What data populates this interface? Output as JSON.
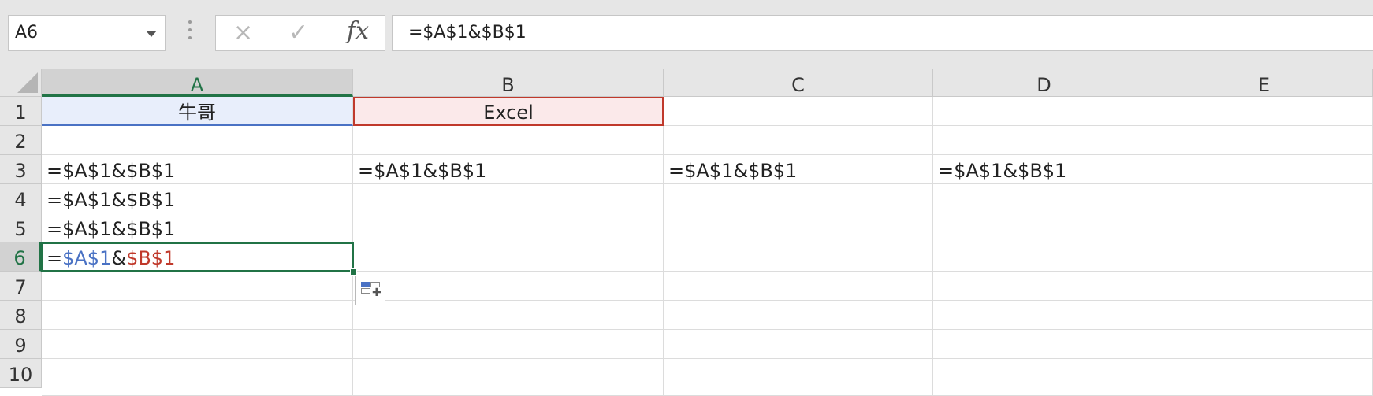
{
  "formula_bar": {
    "name_box": "A6",
    "cancel_icon": "×",
    "enter_icon": "✓",
    "fx_label": "fx",
    "formula": "=$A$1&$B$1"
  },
  "columns": [
    "A",
    "B",
    "C",
    "D",
    "E"
  ],
  "rows": [
    "1",
    "2",
    "3",
    "4",
    "5",
    "6",
    "7",
    "8",
    "9",
    "10"
  ],
  "cells": {
    "A1": "牛哥",
    "B1": "Excel",
    "A3": "=$A$1&$B$1",
    "B3": "=$A$1&$B$1",
    "C3": "=$A$1&$B$1",
    "D3": "=$A$1&$B$1",
    "A4": "=$A$1&$B$1",
    "A5": "=$A$1&$B$1"
  },
  "edit_cell": {
    "address": "A6",
    "eq": "=",
    "ref1": "$A$1",
    "amp": "&",
    "ref2": "$B$1"
  },
  "colors": {
    "accent": "#217346",
    "ref_a": "#4a72c4",
    "ref_b": "#c0392b"
  }
}
